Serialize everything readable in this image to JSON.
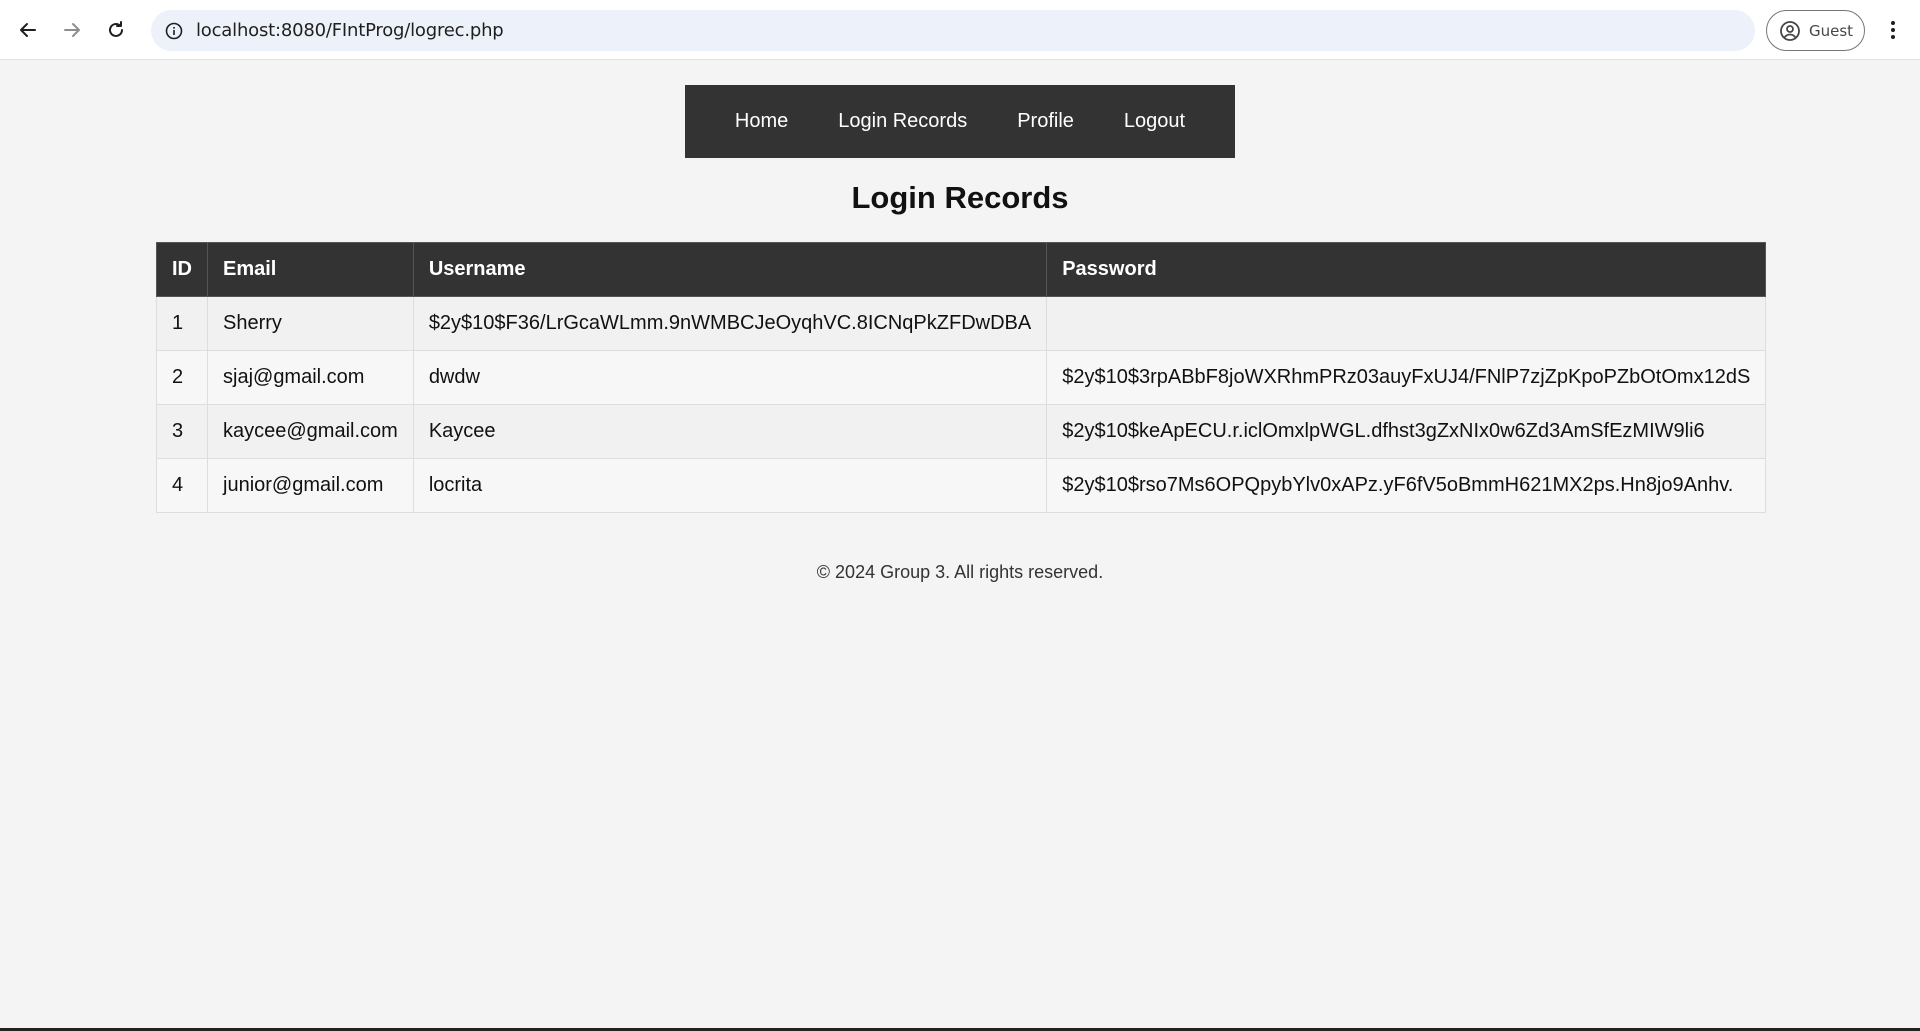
{
  "browser": {
    "url": "localhost:8080/FIntProg/logrec.php",
    "profile_label": "Guest"
  },
  "nav": {
    "items": [
      {
        "label": "Home"
      },
      {
        "label": "Login Records"
      },
      {
        "label": "Profile"
      },
      {
        "label": "Logout"
      }
    ]
  },
  "page_title": "Login Records",
  "table": {
    "headers": [
      "ID",
      "Email",
      "Username",
      "Password"
    ],
    "rows": [
      [
        "1",
        "Sherry",
        "$2y$10$F36/LrGcaWLmm.9nWMBCJeOyqhVC.8ICNqPkZFDwDBA",
        ""
      ],
      [
        "2",
        "sjaj@gmail.com",
        "dwdw",
        "$2y$10$3rpABbF8joWXRhmPRz03auyFxUJ4/FNlP7zjZpKpoPZbOtOmx12dS"
      ],
      [
        "3",
        "kaycee@gmail.com",
        "Kaycee",
        "$2y$10$keApECU.r.iclOmxlpWGL.dfhst3gZxNIx0w6Zd3AmSfEzMIW9li6"
      ],
      [
        "4",
        "junior@gmail.com",
        "locrita",
        "$2y$10$rso7Ms6OPQpybYlv0xAPz.yF6fV5oBmmH621MX2ps.Hn8jo9Anhv."
      ]
    ]
  },
  "footer": "© 2024 Group 3. All rights reserved."
}
